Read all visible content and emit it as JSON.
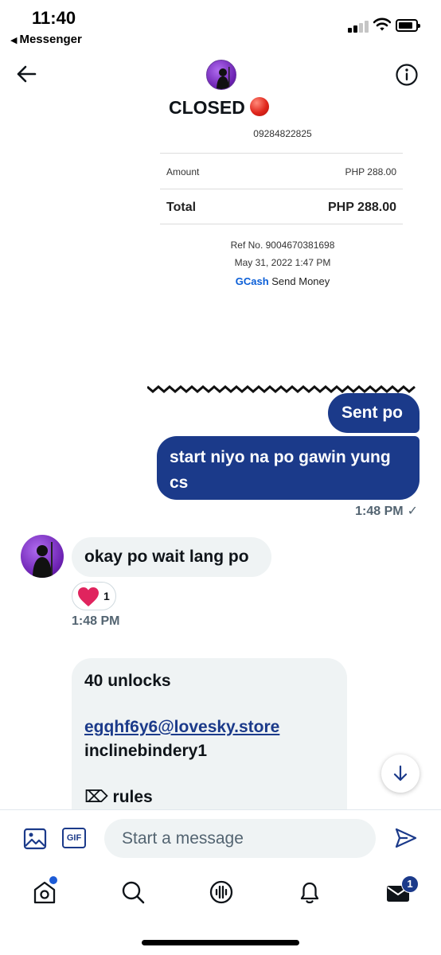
{
  "status_bar": {
    "time": "11:40",
    "back_app": "Messenger"
  },
  "header": {
    "title": "CLOSED"
  },
  "receipt": {
    "number": "09284822825",
    "amount_label": "Amount",
    "amount_value": "PHP 288.00",
    "total_label": "Total",
    "total_value": "PHP 288.00",
    "ref": "Ref No. 9004670381698",
    "date": "May 31, 2022 1:47 PM",
    "brand": "GCash",
    "method": "Send Money"
  },
  "messages": {
    "sent_1": "Sent po",
    "sent_2": "start niyo na po gawin yung cs",
    "sent_time": "1:48 PM",
    "sent_status": "✓",
    "received_1": "okay po wait lang po",
    "reaction_count": "1",
    "received_time": "1:48 PM",
    "received_2_line1": "40 unlocks",
    "received_2_email": "egqhf6y6@lovesky.store",
    "received_2_line3": "inclinebindery1",
    "received_2_line4": "⌦ rules"
  },
  "composer": {
    "gif_label": "GIF",
    "placeholder": "Start a message"
  },
  "nav": {
    "messages_badge": "1"
  },
  "colors": {
    "accent": "#1b3a8a",
    "bubble_received": "#eff3f4",
    "muted": "#536471",
    "reaction": "#e0245e",
    "status_red": "#e0261c"
  }
}
